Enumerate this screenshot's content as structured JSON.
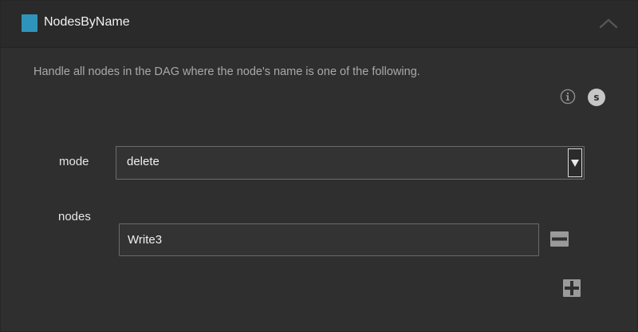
{
  "header": {
    "title": "NodesByName",
    "swatch_color": "#2f94bb",
    "collapse_icon": "chevron-up-icon"
  },
  "description": "Handle all nodes in the DAG where the node's name is one of the following.",
  "badges": {
    "info_icon": "info-icon",
    "s_label": "s"
  },
  "fields": {
    "mode": {
      "label": "mode",
      "value": "delete"
    },
    "nodes": {
      "label": "nodes",
      "items": [
        "Write3"
      ],
      "remove_icon": "minus-icon",
      "add_icon": "plus-icon"
    }
  }
}
